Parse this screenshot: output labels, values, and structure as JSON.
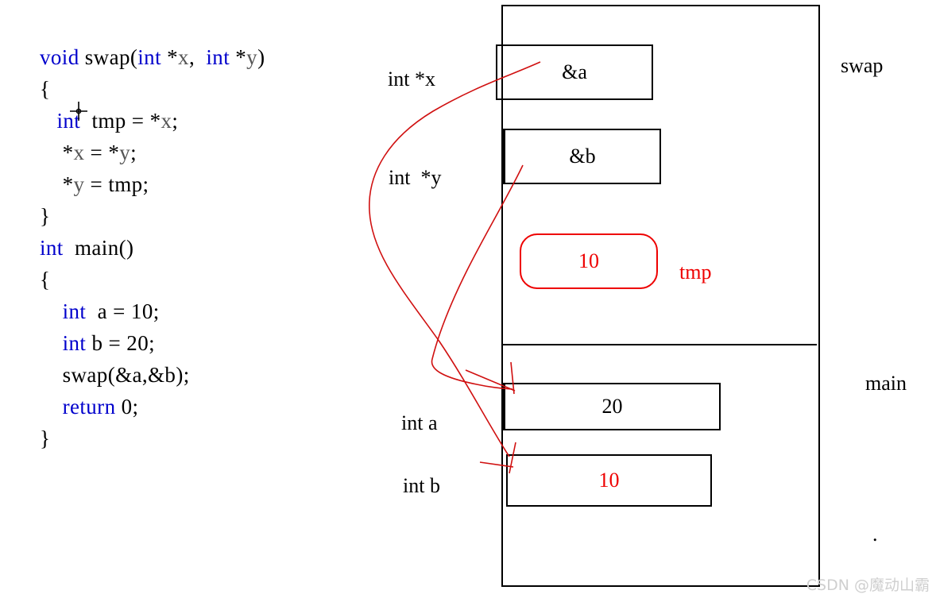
{
  "code": {
    "lines": [
      [
        {
          "t": "void ",
          "c": "kw"
        },
        {
          "t": "swap",
          "c": "plain"
        },
        {
          "t": "(",
          "c": "plain"
        },
        {
          "t": "int ",
          "c": "kw"
        },
        {
          "t": "*",
          "c": "plain"
        },
        {
          "t": "x",
          "c": "var"
        },
        {
          "t": ",  ",
          "c": "plain"
        },
        {
          "t": "int ",
          "c": "kw"
        },
        {
          "t": "*",
          "c": "plain"
        },
        {
          "t": "y",
          "c": "var"
        },
        {
          "t": ")",
          "c": "plain"
        }
      ],
      [
        {
          "t": "{",
          "c": "plain"
        }
      ],
      [
        {
          "t": "   ",
          "c": "plain"
        },
        {
          "t": "int",
          "c": "kw"
        },
        {
          "t": "  tmp = *",
          "c": "plain"
        },
        {
          "t": "x",
          "c": "var"
        },
        {
          "t": ";",
          "c": "plain"
        }
      ],
      [
        {
          "t": "    *",
          "c": "plain"
        },
        {
          "t": "x",
          "c": "var"
        },
        {
          "t": " = *",
          "c": "plain"
        },
        {
          "t": "y",
          "c": "var"
        },
        {
          "t": ";",
          "c": "plain"
        }
      ],
      [
        {
          "t": "    *",
          "c": "plain"
        },
        {
          "t": "y",
          "c": "var"
        },
        {
          "t": " = tmp;",
          "c": "plain"
        }
      ],
      [
        {
          "t": "}",
          "c": "plain"
        }
      ],
      [
        {
          "t": "int",
          "c": "kw"
        },
        {
          "t": "  main()",
          "c": "plain"
        }
      ],
      [
        {
          "t": "{",
          "c": "plain"
        }
      ],
      [
        {
          "t": "    ",
          "c": "plain"
        },
        {
          "t": "int",
          "c": "kw"
        },
        {
          "t": "  a = 10;",
          "c": "plain"
        }
      ],
      [
        {
          "t": "    ",
          "c": "plain"
        },
        {
          "t": "int",
          "c": "kw"
        },
        {
          "t": " b = 20;",
          "c": "plain"
        }
      ],
      [
        {
          "t": "    swap(&a,&b);",
          "c": "plain"
        }
      ],
      [
        {
          "t": "    ",
          "c": "plain"
        },
        {
          "t": "return",
          "c": "kw"
        },
        {
          "t": " 0;",
          "c": "plain"
        }
      ],
      [
        {
          "t": "}",
          "c": "plain"
        }
      ]
    ]
  },
  "diagram": {
    "frames": [
      {
        "name": "swap",
        "label": "swap"
      },
      {
        "name": "main",
        "label": "main"
      }
    ],
    "cells": [
      {
        "name": "param-x-cell",
        "value": "&a",
        "label": "int *x",
        "color": "#000000"
      },
      {
        "name": "param-y-cell",
        "value": "&b",
        "label": "int  *y",
        "color": "#000000"
      },
      {
        "name": "tmp-cell",
        "value": "10",
        "label": "tmp",
        "color": "#ee0000"
      },
      {
        "name": "var-a-cell",
        "value": "20",
        "label": "int a",
        "color": "#000000"
      },
      {
        "name": "var-b-cell",
        "value": "10",
        "label": "int b",
        "color": "#ee0000"
      }
    ],
    "marker_dot": "."
  },
  "watermark": {
    "text": "CSDN @魔动山霸"
  },
  "colors": {
    "keyword": "#0000cc",
    "variable": "#555555",
    "highlight": "#ee0000",
    "outline": "#000000",
    "watermark": "#cfcfcf"
  }
}
